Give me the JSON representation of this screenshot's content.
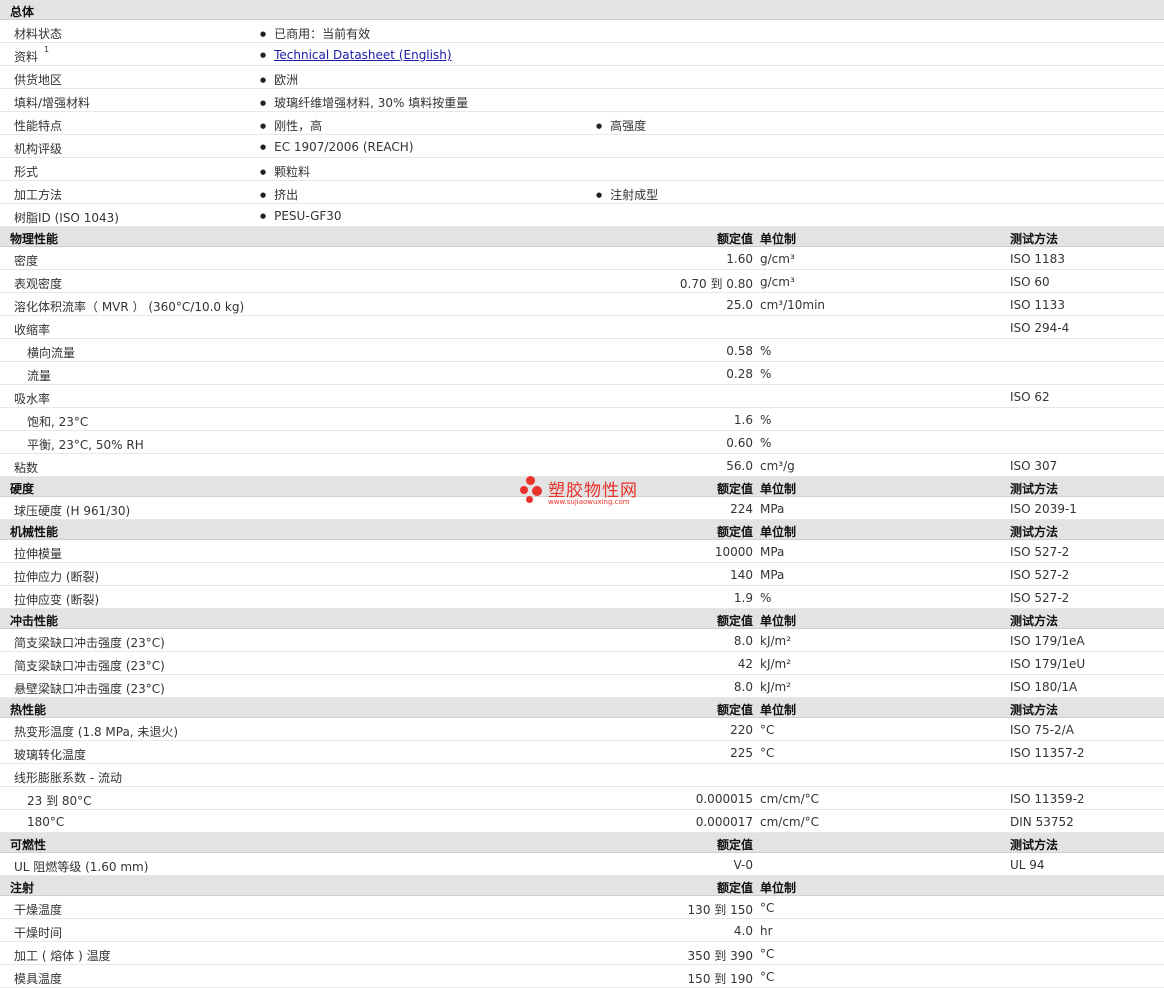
{
  "general": {
    "title": "总体",
    "rows": [
      {
        "label": "材料状态",
        "b1": "已商用：当前有效",
        "b2": ""
      },
      {
        "label": "资料",
        "sup": "1",
        "b1": "Technical Datasheet (English)",
        "link": true,
        "b2": ""
      },
      {
        "label": "供货地区",
        "b1": "欧洲",
        "b2": ""
      },
      {
        "label": "填料/增强材料",
        "b1": "玻璃纤维增强材料, 30% 填料按重量",
        "b2": ""
      },
      {
        "label": "性能特点",
        "b1": "刚性，高",
        "b2": "高强度"
      },
      {
        "label": "机构评级",
        "b1": "EC 1907/2006 (REACH)",
        "b2": ""
      },
      {
        "label": "形式",
        "b1": "颗粒料",
        "b2": ""
      },
      {
        "label": "加工方法",
        "b1": "挤出",
        "b2": "注射成型"
      },
      {
        "label": "树脂ID (ISO 1043)",
        "b1": "PESU-GF30",
        "b2": ""
      }
    ]
  },
  "sections": [
    {
      "title": "物理性能",
      "hv": "额定值",
      "hu": "单位制",
      "hm": "测试方法",
      "rows": [
        {
          "label": "密度",
          "value": "1.60",
          "unit": "g/cm³",
          "method": "ISO 1183"
        },
        {
          "label": "表观密度",
          "value": "0.70 到  0.80",
          "unit": "g/cm³",
          "method": "ISO 60"
        },
        {
          "label": "溶化体积流率（ MVR ） (360°C/10.0 kg)",
          "value": "25.0",
          "unit": "cm³/10min",
          "method": "ISO 1133"
        },
        {
          "label": "收缩率",
          "value": "",
          "unit": "",
          "method": "ISO 294-4"
        },
        {
          "label": "横向流量",
          "sub": true,
          "value": "0.58",
          "unit": "%",
          "method": ""
        },
        {
          "label": "流量",
          "sub": true,
          "value": "0.28",
          "unit": "%",
          "method": ""
        },
        {
          "label": "吸水率",
          "value": "",
          "unit": "",
          "method": "ISO 62"
        },
        {
          "label": "饱和, 23°C",
          "sub": true,
          "value": "1.6",
          "unit": "%",
          "method": ""
        },
        {
          "label": "平衡, 23°C, 50% RH",
          "sub": true,
          "value": "0.60",
          "unit": "%",
          "method": ""
        },
        {
          "label": "粘数",
          "value": "56.0",
          "unit": "cm³/g",
          "method": "ISO 307"
        }
      ]
    },
    {
      "title": "硬度",
      "hv": "额定值",
      "hu": "单位制",
      "hm": "测试方法",
      "rows": [
        {
          "label": "球压硬度 (H 961/30)",
          "value": "224",
          "unit": "MPa",
          "method": "ISO 2039-1"
        }
      ]
    },
    {
      "title": "机械性能",
      "hv": "额定值",
      "hu": "单位制",
      "hm": "测试方法",
      "rows": [
        {
          "label": "拉伸模量",
          "value": "10000",
          "unit": "MPa",
          "method": "ISO 527-2"
        },
        {
          "label": "拉伸应力 (断裂)",
          "value": "140",
          "unit": "MPa",
          "method": "ISO 527-2"
        },
        {
          "label": "拉伸应变 (断裂)",
          "value": "1.9",
          "unit": "%",
          "method": "ISO 527-2"
        }
      ]
    },
    {
      "title": "冲击性能",
      "hv": "额定值",
      "hu": "单位制",
      "hm": "测试方法",
      "rows": [
        {
          "label": "简支梁缺口冲击强度 (23°C)",
          "value": "8.0",
          "unit": "kJ/m²",
          "method": "ISO 179/1eA"
        },
        {
          "label": "简支梁缺口冲击强度 (23°C)",
          "value": "42",
          "unit": "kJ/m²",
          "method": "ISO 179/1eU"
        },
        {
          "label": "悬壁梁缺口冲击强度 (23°C)",
          "value": "8.0",
          "unit": "kJ/m²",
          "method": "ISO 180/1A"
        }
      ]
    },
    {
      "title": "热性能",
      "hv": "额定值",
      "hu": "单位制",
      "hm": "测试方法",
      "rows": [
        {
          "label": "热变形温度 (1.8 MPa, 未退火)",
          "value": "220",
          "unit": "°C",
          "method": "ISO 75-2/A"
        },
        {
          "label": "玻璃转化温度",
          "value": "225",
          "unit": "°C",
          "method": "ISO 11357-2"
        },
        {
          "label": "线形膨胀系数  - 流动",
          "value": "",
          "unit": "",
          "method": ""
        },
        {
          "label": "23 到  80°C",
          "sub": true,
          "value": "0.000015",
          "unit": "cm/cm/°C",
          "method": "ISO 11359-2"
        },
        {
          "label": "180°C",
          "sub": true,
          "value": "0.000017",
          "unit": "cm/cm/°C",
          "method": "DIN 53752"
        }
      ]
    },
    {
      "title": "可燃性",
      "hv": "额定值",
      "hu": "",
      "hm": "测试方法",
      "rows": [
        {
          "label": "UL 阻燃等级 (1.60 mm)",
          "value": "V-0",
          "unit": "",
          "method": "UL 94"
        }
      ]
    },
    {
      "title": "注射",
      "hv": "额定值",
      "hu": "单位制",
      "hm": "",
      "rows": [
        {
          "label": "干燥温度",
          "value": "130 到  150",
          "unit": "°C",
          "method": ""
        },
        {
          "label": "干燥时间",
          "value": "4.0",
          "unit": "hr",
          "method": ""
        },
        {
          "label": "加工 ( 熔体 ) 温度",
          "value": "350 到  390",
          "unit": "°C",
          "method": ""
        },
        {
          "label": "模具温度",
          "value": "150 到  190",
          "unit": "°C",
          "method": ""
        }
      ]
    }
  ],
  "watermark": {
    "name": "塑胶物性网",
    "url": "www.sujiaowuxing.com",
    "color": "#e8322c"
  }
}
